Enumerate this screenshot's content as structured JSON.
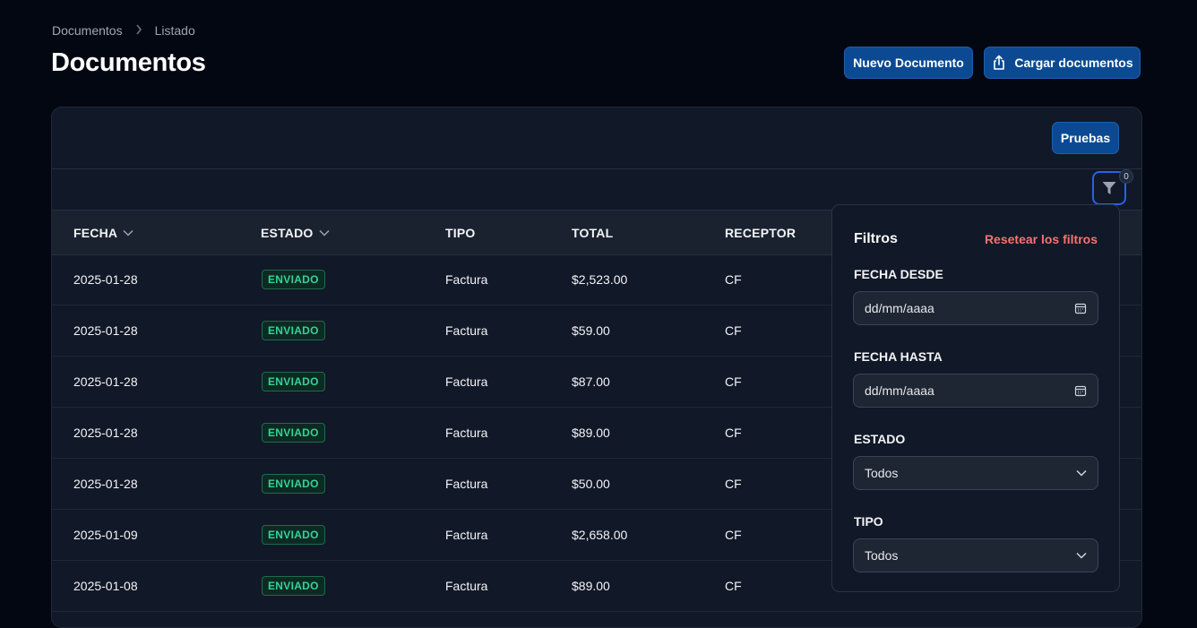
{
  "breadcrumb": {
    "root": "Documentos",
    "current": "Listado"
  },
  "page": {
    "title": "Documentos"
  },
  "actions": {
    "new_document": "Nuevo Documento",
    "upload_documents": "Cargar documentos",
    "tests": "Pruebas"
  },
  "table": {
    "headers": {
      "fecha": "FECHA",
      "estado": "ESTADO",
      "tipo": "TIPO",
      "total": "TOTAL",
      "receptor": "RECEPTOR"
    },
    "rows": [
      {
        "fecha": "2025-01-28",
        "estado": "ENVIADO",
        "tipo": "Factura",
        "total": "$2,523.00",
        "receptor": "CF"
      },
      {
        "fecha": "2025-01-28",
        "estado": "ENVIADO",
        "tipo": "Factura",
        "total": "$59.00",
        "receptor": "CF"
      },
      {
        "fecha": "2025-01-28",
        "estado": "ENVIADO",
        "tipo": "Factura",
        "total": "$87.00",
        "receptor": "CF"
      },
      {
        "fecha": "2025-01-28",
        "estado": "ENVIADO",
        "tipo": "Factura",
        "total": "$89.00",
        "receptor": "CF"
      },
      {
        "fecha": "2025-01-28",
        "estado": "ENVIADO",
        "tipo": "Factura",
        "total": "$50.00",
        "receptor": "CF"
      },
      {
        "fecha": "2025-01-09",
        "estado": "ENVIADO",
        "tipo": "Factura",
        "total": "$2,658.00",
        "receptor": "CF"
      },
      {
        "fecha": "2025-01-08",
        "estado": "ENVIADO",
        "tipo": "Factura",
        "total": "$89.00",
        "receptor": "CF"
      }
    ]
  },
  "filters": {
    "count": "0",
    "title": "Filtros",
    "reset": "Resetear los filtros",
    "date_from": {
      "label": "FECHA DESDE",
      "placeholder": "dd/mm/aaaa"
    },
    "date_to": {
      "label": "FECHA HASTA",
      "placeholder": "dd/mm/aaaa"
    },
    "status": {
      "label": "ESTADO",
      "value": "Todos"
    },
    "type": {
      "label": "TIPO",
      "value": "Todos"
    }
  },
  "icons": {
    "breadcrumb_separator": "chevron-right-icon",
    "sort": "chevron-down-icon",
    "upload": "share-upload-icon",
    "filter": "funnel-icon",
    "calendar": "calendar-icon",
    "select": "chevron-down-icon"
  },
  "colors": {
    "primary": "#0b4a93",
    "status_sent": "#34d399",
    "reset": "#f87171",
    "focus": "#2563eb"
  }
}
